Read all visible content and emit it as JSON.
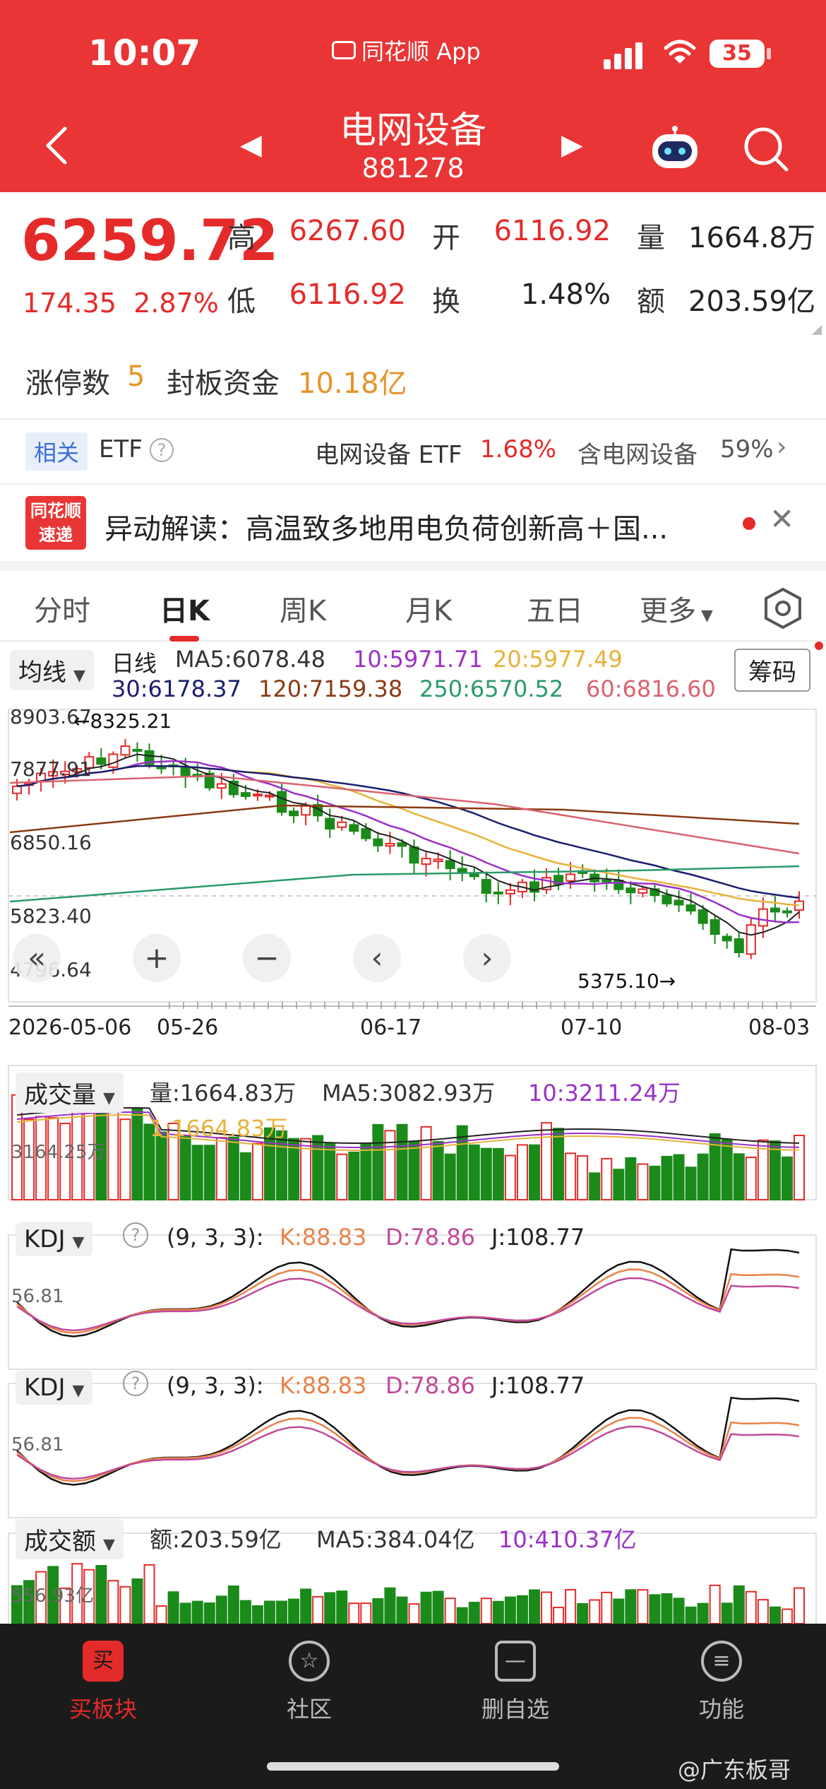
{
  "status": {
    "time": "10:07",
    "app_name": "同花顺 App",
    "battery": "35"
  },
  "nav": {
    "title": "电网设备",
    "code": "881278"
  },
  "quote": {
    "price": "6259.72",
    "change": "174.35",
    "change_pct": "2.87%",
    "high_label": "高",
    "high": "6267.60",
    "open_label": "开",
    "open": "6116.92",
    "vol_label": "量",
    "vol": "1664.8万",
    "low_label": "低",
    "low": "6116.92",
    "turnover_label": "换",
    "turnover": "1.48%",
    "amount_label": "额",
    "amount": "203.59亿"
  },
  "limit": {
    "count_label": "涨停数",
    "count": "5",
    "fund_label": "封板资金",
    "fund": "10.18亿"
  },
  "etf": {
    "badge": "相关",
    "label": "ETF",
    "help": "?",
    "name": "电网设备 ETF",
    "pct": "1.68%",
    "hold_label": "含电网设备",
    "hold_pct": "59%"
  },
  "news": {
    "logo_top": "同花顺",
    "logo_bottom": "速递",
    "text": "异动解读：高温致多地用电负荷创新高＋国..."
  },
  "tabs": [
    "分时",
    "日K",
    "周K",
    "月K",
    "五日",
    "更多"
  ],
  "kchart": {
    "indicator_chip": "均线",
    "line_type": "日线",
    "chips_button": "筹码",
    "ma5": "MA5:6078.48",
    "ma10": "10:5971.71",
    "ma20": "20:5977.49",
    "ma30": "30:6178.37",
    "ma120": "120:7159.38",
    "ma250": "250:6570.52",
    "ma60": "60:6816.60",
    "y_labels": [
      "8903.67",
      "7877.91",
      "6850.16",
      "5823.40",
      "4796.64"
    ],
    "high_marker": "←8325.21",
    "low_marker": "5375.10→",
    "dates": [
      "2026-05-06",
      "05-26",
      "06-17",
      "07-10",
      "08-03"
    ],
    "colors": {
      "ma5": "#222222",
      "ma10": "#9b30c8",
      "ma20": "#e8b23a",
      "ma30": "#1a1f6e",
      "ma120": "#8a3a14",
      "ma250": "#2a9a6a",
      "ma60": "#d9636f",
      "up": "#e52a2a",
      "down": "#1a8a1a"
    }
  },
  "volume": {
    "chip": "成交量",
    "vol": "量:1664.83万",
    "ma5": "MA5:3082.93万",
    "ma10": "10:3211.24万",
    "ma1": "1:1664.83万",
    "y_label": "3164.25万"
  },
  "kdj1": {
    "chip": "KDJ",
    "help": "?",
    "params": "(9, 3, 3):",
    "k": "K:88.83",
    "d": "D:78.86",
    "j": "J:108.77",
    "y_label": "56.81"
  },
  "kdj2": {
    "chip": "KDJ",
    "help": "?",
    "params": "(9, 3, 3):",
    "k": "K:88.83",
    "d": "D:78.86",
    "j": "J:108.77",
    "y_label": "56.81"
  },
  "amount": {
    "chip": "成交额",
    "amt": "额:203.59亿",
    "ma5": "MA5:384.04亿",
    "ma10": "10:410.37亿",
    "y_label": "556.93亿"
  },
  "tabbar": [
    {
      "icon": "买",
      "label": "买板块"
    },
    {
      "icon": "☆",
      "label": "社区"
    },
    {
      "icon": "—",
      "label": "删自选"
    },
    {
      "icon": "≡",
      "label": "功能"
    }
  ],
  "watermark": "@广东板哥"
}
